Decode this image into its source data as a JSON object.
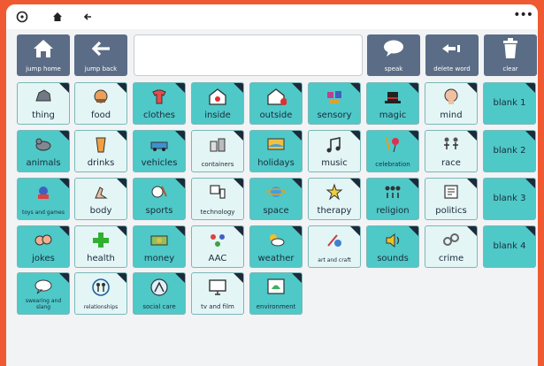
{
  "topbar": {
    "icons": [
      "compass-icon",
      "home-icon",
      "back-arrow-icon"
    ],
    "menu_icon": "more-icon"
  },
  "controls": [
    {
      "label": "jump home",
      "icon": "house-icon"
    },
    {
      "label": "jump back",
      "icon": "left-arrow-icon"
    },
    {
      "label": "speak",
      "icon": "speech-bubble-icon"
    },
    {
      "label": "delete word",
      "icon": "backspace-icon"
    },
    {
      "label": "clear",
      "icon": "trash-icon"
    }
  ],
  "message_bar": {
    "value": ""
  },
  "tiles": [
    {
      "label": "thing",
      "type": "item",
      "icon": "rock-icon"
    },
    {
      "label": "food",
      "type": "item",
      "icon": "food-icon"
    },
    {
      "label": "clothes",
      "type": "folder",
      "icon": "clothes-icon"
    },
    {
      "label": "inside",
      "type": "folder",
      "icon": "inside-icon"
    },
    {
      "label": "outside",
      "type": "folder",
      "icon": "outside-icon"
    },
    {
      "label": "sensory",
      "type": "folder",
      "icon": "sensory-icon"
    },
    {
      "label": "magic",
      "type": "folder",
      "icon": "magic-hat-icon"
    },
    {
      "label": "mind",
      "type": "item",
      "icon": "head-icon"
    },
    {
      "label": "blank 1",
      "type": "blank",
      "icon": ""
    },
    {
      "label": "animals",
      "type": "folder",
      "icon": "animals-icon"
    },
    {
      "label": "drinks",
      "type": "item",
      "icon": "drink-icon"
    },
    {
      "label": "vehicles",
      "type": "folder",
      "icon": "vehicles-icon"
    },
    {
      "label": "containers",
      "type": "item",
      "icon": "containers-icon"
    },
    {
      "label": "holidays",
      "type": "folder",
      "icon": "holidays-icon"
    },
    {
      "label": "music",
      "type": "item",
      "icon": "music-icon"
    },
    {
      "label": "celebration",
      "type": "folder",
      "icon": "celebration-icon"
    },
    {
      "label": "race",
      "type": "item",
      "icon": "race-icon"
    },
    {
      "label": "blank 2",
      "type": "blank",
      "icon": ""
    },
    {
      "label": "toys and games",
      "type": "folder",
      "icon": "toys-icon"
    },
    {
      "label": "body",
      "type": "item",
      "icon": "body-icon"
    },
    {
      "label": "sports",
      "type": "folder",
      "icon": "sports-icon"
    },
    {
      "label": "technology",
      "type": "item",
      "icon": "technology-icon"
    },
    {
      "label": "space",
      "type": "folder",
      "icon": "space-icon"
    },
    {
      "label": "therapy",
      "type": "item",
      "icon": "therapy-icon"
    },
    {
      "label": "religion",
      "type": "folder",
      "icon": "religion-icon"
    },
    {
      "label": "politics",
      "type": "item",
      "icon": "politics-icon"
    },
    {
      "label": "blank 3",
      "type": "blank",
      "icon": ""
    },
    {
      "label": "jokes",
      "type": "folder",
      "icon": "jokes-icon"
    },
    {
      "label": "health",
      "type": "item",
      "icon": "health-cross-icon"
    },
    {
      "label": "money",
      "type": "folder",
      "icon": "money-icon"
    },
    {
      "label": "AAC",
      "type": "item",
      "icon": "aac-icon"
    },
    {
      "label": "weather",
      "type": "folder",
      "icon": "weather-icon"
    },
    {
      "label": "art and craft",
      "type": "item",
      "icon": "art-icon"
    },
    {
      "label": "sounds",
      "type": "folder",
      "icon": "speaker-icon"
    },
    {
      "label": "crime",
      "type": "item",
      "icon": "handcuffs-icon"
    },
    {
      "label": "blank 4",
      "type": "blank",
      "icon": ""
    },
    {
      "label": "swearing and slang",
      "type": "folder",
      "icon": "swearing-icon"
    },
    {
      "label": "relationships",
      "type": "item",
      "icon": "relationships-icon"
    },
    {
      "label": "social care",
      "type": "folder",
      "icon": "social-care-icon"
    },
    {
      "label": "tv and film",
      "type": "item",
      "icon": "tv-icon"
    },
    {
      "label": "environment",
      "type": "folder",
      "icon": "environment-icon"
    }
  ]
}
